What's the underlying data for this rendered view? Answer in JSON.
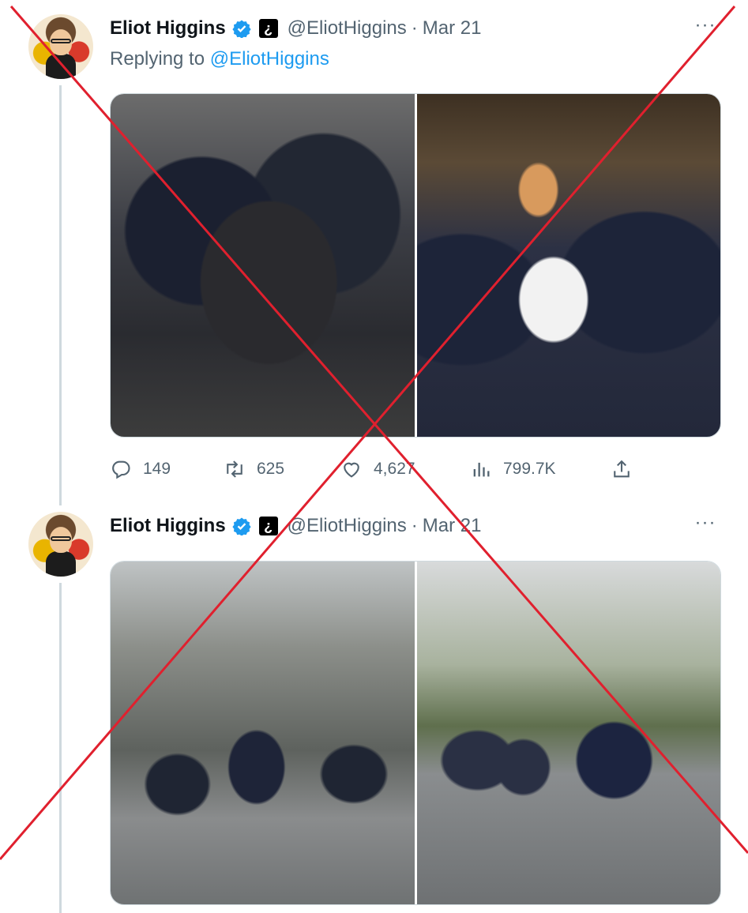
{
  "tweets": [
    {
      "display_name": "Eliot Higgins",
      "handle": "@EliotHiggins",
      "separator": "·",
      "date": "Mar 21",
      "reply_prefix": "Replying to",
      "reply_to": "@EliotHiggins",
      "actions": {
        "replies": "149",
        "retweets": "625",
        "likes": "4,627",
        "views": "799.7K"
      }
    },
    {
      "display_name": "Eliot Higgins",
      "handle": "@EliotHiggins",
      "separator": "·",
      "date": "Mar 21"
    }
  ],
  "icons": {
    "verified": "verified-badge-icon",
    "affiliation": "question-mark-badge-icon",
    "more": "more-horizontal-icon",
    "reply": "reply-icon",
    "retweet": "retweet-icon",
    "like": "heart-icon",
    "views": "views-bar-chart-icon",
    "share": "share-icon"
  },
  "colors": {
    "accent": "#1d9bf0",
    "secondary_text": "#536471",
    "overlay_cross": "#e0202e"
  }
}
